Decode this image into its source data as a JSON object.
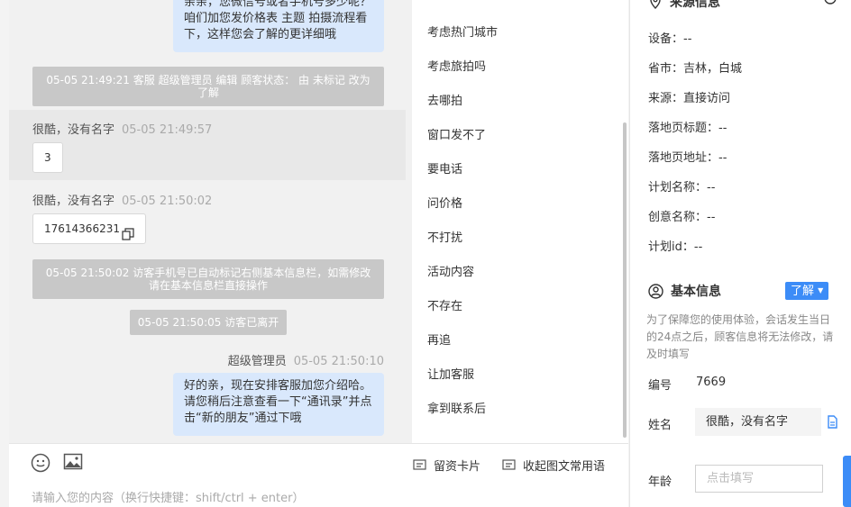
{
  "chat": {
    "messages": {
      "out_top": "亲亲，您微信号或者手机号多少呢？咱们加您发价格表 主题 拍摄流程看下，这样您会了解的更详细哦",
      "sys_edit": "05-05 21:49:21 客服 超级管理员 编辑 顾客状态： 由 未标记 改为 了解",
      "visitor1_name": "很酷，没有名字",
      "visitor1_time": "05-05 21:49:57",
      "visitor1_text": "3",
      "visitor2_name": "很酷，没有名字",
      "visitor2_time": "05-05 21:50:02",
      "visitor2_text": "17614366231",
      "sys_phone": "05-05 21:50:02 访客手机号已自动标记右侧基本信息栏，如需修改请在基本信息栏直接操作",
      "sys_left": "05-05 21:50:05 访客已离开",
      "agent_name": "超级管理员",
      "agent_time": "05-05 21:50:10",
      "agent_text": "好的亲，现在安排客服加您介绍哈。请您稍后注意查看一下“通讯录”并点击“新的朋友”通过下哦"
    }
  },
  "input": {
    "placeholder": "请输入您的内容（换行快捷键：shift/ctrl + enter）",
    "card_label": "留资卡片",
    "collect_label": "收起图文常用语"
  },
  "quick_phrases": {
    "items": [
      "考虑热门城市",
      "考虑旅拍吗",
      "去哪拍",
      "窗口发不了",
      "要电话",
      "问价格",
      "不打扰",
      "活动内容",
      "不存在",
      "再追",
      "让加客服",
      "拿到联系后"
    ]
  },
  "info": {
    "source_title": "来源信息",
    "source": [
      {
        "label": "设备：",
        "value": "--"
      },
      {
        "label": "省市：",
        "value": "吉林，白城"
      },
      {
        "label": "来源：",
        "value": "直接访问"
      },
      {
        "label": "落地页标题：",
        "value": "--"
      },
      {
        "label": "落地页地址：",
        "value": "--"
      },
      {
        "label": "计划名称：",
        "value": "--"
      },
      {
        "label": "创意名称：",
        "value": "--"
      },
      {
        "label": "计划id：",
        "value": "--"
      }
    ],
    "basic_title": "基本信息",
    "status_badge": "了解",
    "notice": "为了保障您的使用体验，会话发生当日的24点之后，顾客信息将无法修改，请及时填写",
    "id_label": "编号",
    "id_value": "7669",
    "name_label": "姓名",
    "name_value": "很酷，没有名字",
    "age_label": "年龄",
    "age_placeholder": "点击填写"
  },
  "colors": {
    "accent": "#3c8cf7",
    "bubble_out": "#d9e8fc",
    "system_msg": "#c8c8c8"
  }
}
